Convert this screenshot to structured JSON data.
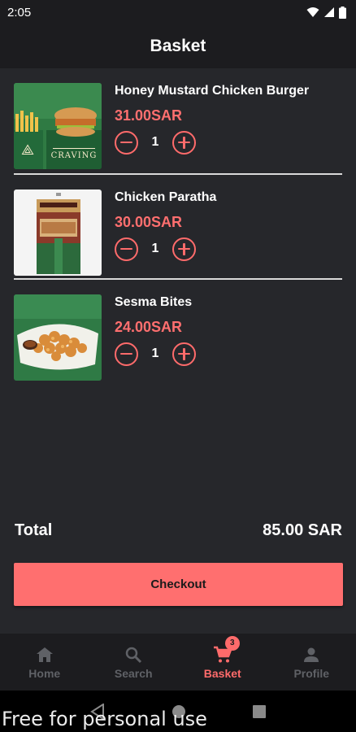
{
  "status_bar": {
    "time": "2:05"
  },
  "header": {
    "title": "Basket"
  },
  "basket": {
    "items": [
      {
        "name": "Honey Mustard Chicken Burger",
        "price": "31.00SAR",
        "quantity": "1"
      },
      {
        "name": "Chicken Paratha",
        "price": "30.00SAR",
        "quantity": "1"
      },
      {
        "name": "Sesma Bites",
        "price": "24.00SAR",
        "quantity": "1"
      }
    ],
    "brand_text": "CRAVING"
  },
  "summary": {
    "total_label": "Total",
    "total_value": "85.00 SAR"
  },
  "checkout": {
    "label": "Checkout"
  },
  "bottom_nav": {
    "items": [
      {
        "label": "Home",
        "icon": "home-icon"
      },
      {
        "label": "Search",
        "icon": "search-icon"
      },
      {
        "label": "Basket",
        "icon": "cart-icon",
        "badge": "3",
        "active": true
      },
      {
        "label": "Profile",
        "icon": "person-icon"
      }
    ]
  },
  "watermark": "Free for personal use",
  "colors": {
    "accent": "#ff6b6b",
    "background": "#26272b",
    "bar": "#1c1c1f"
  }
}
